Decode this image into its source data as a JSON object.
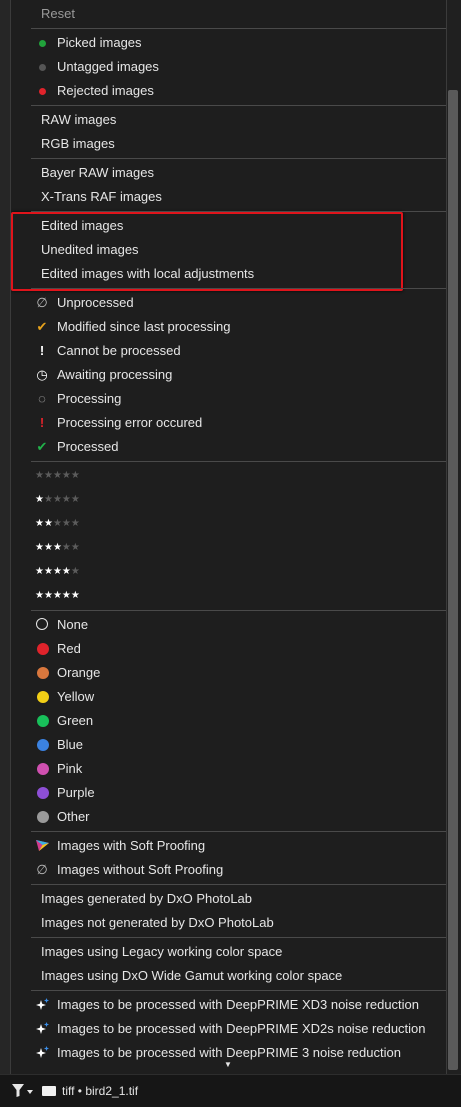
{
  "menu": {
    "reset": "Reset",
    "picks": [
      {
        "label": "Picked images",
        "color": "#21a33b"
      },
      {
        "label": "Untagged images",
        "color": "#555555"
      },
      {
        "label": "Rejected images",
        "color": "#e0232b"
      }
    ],
    "raw_rgb": [
      "RAW images",
      "RGB images"
    ],
    "sensor": [
      "Bayer RAW images",
      "X-Trans RAF images"
    ],
    "edited": [
      "Edited images",
      "Unedited images",
      "Edited images with local adjustments"
    ],
    "processing": [
      {
        "label": "Unprocessed",
        "icon": "empty-set-icon",
        "glyph": "∅",
        "color": "#bdbdbd"
      },
      {
        "label": "Modified since last processing",
        "icon": "check-icon",
        "glyph": "✔",
        "color": "#e6a21c"
      },
      {
        "label": "Cannot be processed",
        "icon": "exclamation-icon",
        "glyph": "!",
        "color": "#ffffff"
      },
      {
        "label": "Awaiting processing",
        "icon": "clock-icon",
        "glyph": "◷",
        "color": "#ffffff"
      },
      {
        "label": "Processing",
        "icon": "spinner-icon",
        "glyph": "◌",
        "color": "#cfcfcf"
      },
      {
        "label": "Processing error occured",
        "icon": "error-icon",
        "glyph": "!",
        "color": "#e0232b"
      },
      {
        "label": "Processed",
        "icon": "check-icon",
        "glyph": "✔",
        "color": "#21b34a"
      }
    ],
    "ratings": [
      0,
      1,
      2,
      3,
      4,
      5
    ],
    "colors": [
      {
        "label": "None",
        "color": "none"
      },
      {
        "label": "Red",
        "color": "#e0232b"
      },
      {
        "label": "Orange",
        "color": "#d9773d"
      },
      {
        "label": "Yellow",
        "color": "#f2cf16"
      },
      {
        "label": "Green",
        "color": "#18c05a"
      },
      {
        "label": "Blue",
        "color": "#3b82e0"
      },
      {
        "label": "Pink",
        "color": "#d050b0"
      },
      {
        "label": "Purple",
        "color": "#8e4fd6"
      },
      {
        "label": "Other",
        "color": "#9a9a9a"
      }
    ],
    "softproof": [
      "Images with Soft Proofing",
      "Images without Soft Proofing"
    ],
    "generated": [
      "Images generated by DxO PhotoLab",
      "Images not generated by DxO PhotoLab"
    ],
    "colorspace": [
      "Images using Legacy working color space",
      "Images using DxO Wide Gamut working color space"
    ],
    "deepprime": [
      "Images to be processed with DeepPRIME XD3 noise reduction",
      "Images to be processed with DeepPRIME XD2s noise reduction",
      "Images to be processed with DeepPRIME 3 noise reduction"
    ]
  },
  "status": {
    "folder": "tiff",
    "separator": "•",
    "file": "bird2_1.tif"
  }
}
